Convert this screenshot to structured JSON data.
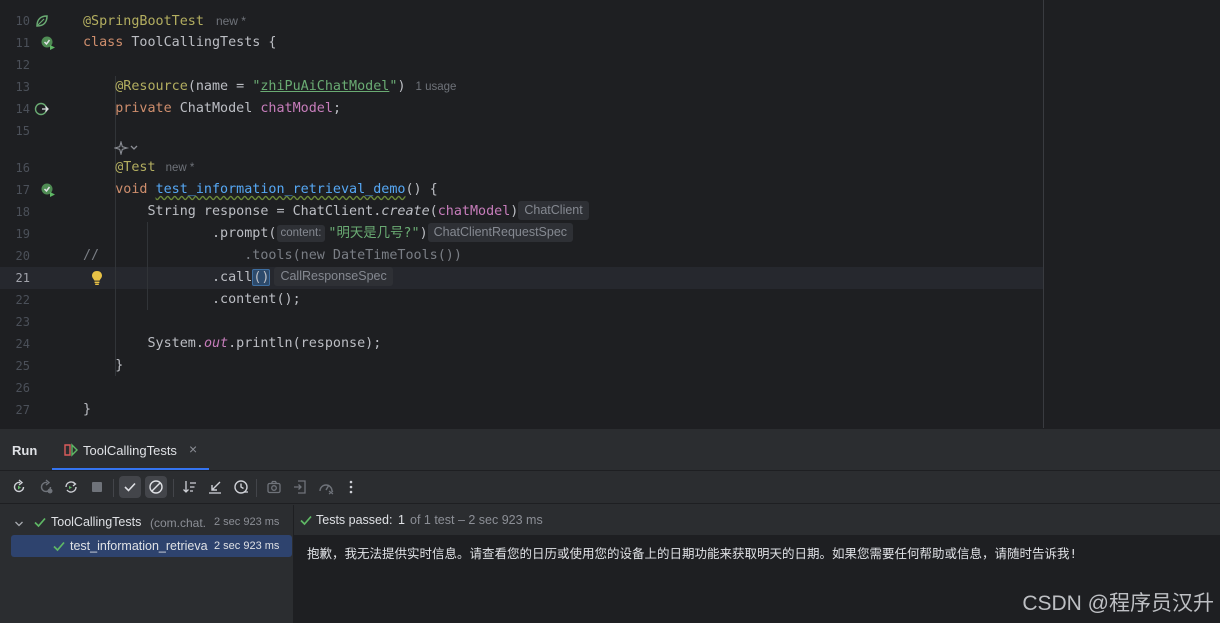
{
  "editor": {
    "line_numbers": [
      "10",
      "11",
      "12",
      "13",
      "14",
      "15",
      "16",
      "17",
      "18",
      "19",
      "20",
      "21",
      "22",
      "23",
      "24",
      "25",
      "26",
      "27"
    ],
    "current_line": "21",
    "code": {
      "l10_annotation": "@SpringBootTest",
      "l10_meta": "new *",
      "l11_class": "class",
      "l11_name": " ToolCallingTests {",
      "l13_annotation": "@Resource",
      "l13_open": "(name = ",
      "l13_quote_open": "\"",
      "l13_value": "zhiPuAiChatModel",
      "l13_quote_close": "\"",
      "l13_close": ")",
      "l13_meta": "1 usage",
      "l14_private": "private",
      "l14_type": " ChatModel ",
      "l14_field": "chatModel",
      "l14_end": ";",
      "l16_annotation": "@Test",
      "l16_meta": "new *",
      "l17_void": "void",
      "l17_method": "test_information_retrieval_demo",
      "l17_end": "() {",
      "l18_prefix": "String response = ChatClient.",
      "l18_create": "create",
      "l18_open": "(",
      "l18_arg": "chatModel",
      "l18_close": ")",
      "l18_hint": "ChatClient",
      "l19_call": ".prompt(",
      "l19_param": "content:",
      "l19_string": "\"明天是几号?\"",
      "l19_close": ")",
      "l19_hint": "ChatClientRequestSpec",
      "l20_comment_slash": "//",
      "l20_comment_body": ".tools(new DateTimeTools())",
      "l21_call": ".call",
      "l21_parens": "()",
      "l21_hint": "CallResponseSpec",
      "l22_call": ".content();",
      "l24_prefix": "System.",
      "l24_out": "out",
      "l24_rest": ".println(response);",
      "l25_brace": "}",
      "l27_brace": "}"
    },
    "gutter_icons": {
      "l10": "spring-leaf-icon",
      "l11": "run-test-icon",
      "l14": "bean-navigate-icon",
      "l16_above": "ai-sparkle-icon",
      "l17": "run-test-icon",
      "l21": "lightbulb-icon"
    }
  },
  "run_panel": {
    "title": "Run",
    "tab_label": "ToolCallingTests",
    "tab_close": "×",
    "toolbar_icons": [
      "rerun-icon",
      "rerun-failed-icon",
      "toggle-auto-test-icon",
      "stop-icon",
      "show-passed-icon",
      "show-ignored-icon",
      "sort-icon",
      "collapse-icon",
      "history-icon",
      "screenshot-icon",
      "import-icon",
      "coverage-icon",
      "more-icon"
    ],
    "tree": [
      {
        "label": "ToolCallingTests",
        "pkg": "(com.chat.",
        "time": "2 sec 923 ms",
        "expanded": true
      },
      {
        "label": "test_information_retrieva",
        "time": "2 sec 923 ms",
        "selected": true
      }
    ],
    "status": {
      "passed_label": "Tests passed:",
      "passed_count": "1",
      "passed_rest": "of 1 test – 2 sec 923 ms"
    },
    "output": "抱歉，我无法提供实时信息。请查看您的日历或使用您的设备上的日期功能来获取明天的日期。如果您需要任何帮助或信息，请随时告诉我!"
  },
  "watermark": "CSDN @程序员汉升",
  "colors": {
    "editor_bg": "#1e1f22",
    "panel_bg": "#2b2d30",
    "keyword": "#cf8e6d",
    "annotation": "#b3ae60",
    "string": "#6aab73",
    "field": "#c77dbb",
    "function": "#56a8f5",
    "pass_green": "#5fb865",
    "accent_blue": "#3574f0"
  }
}
